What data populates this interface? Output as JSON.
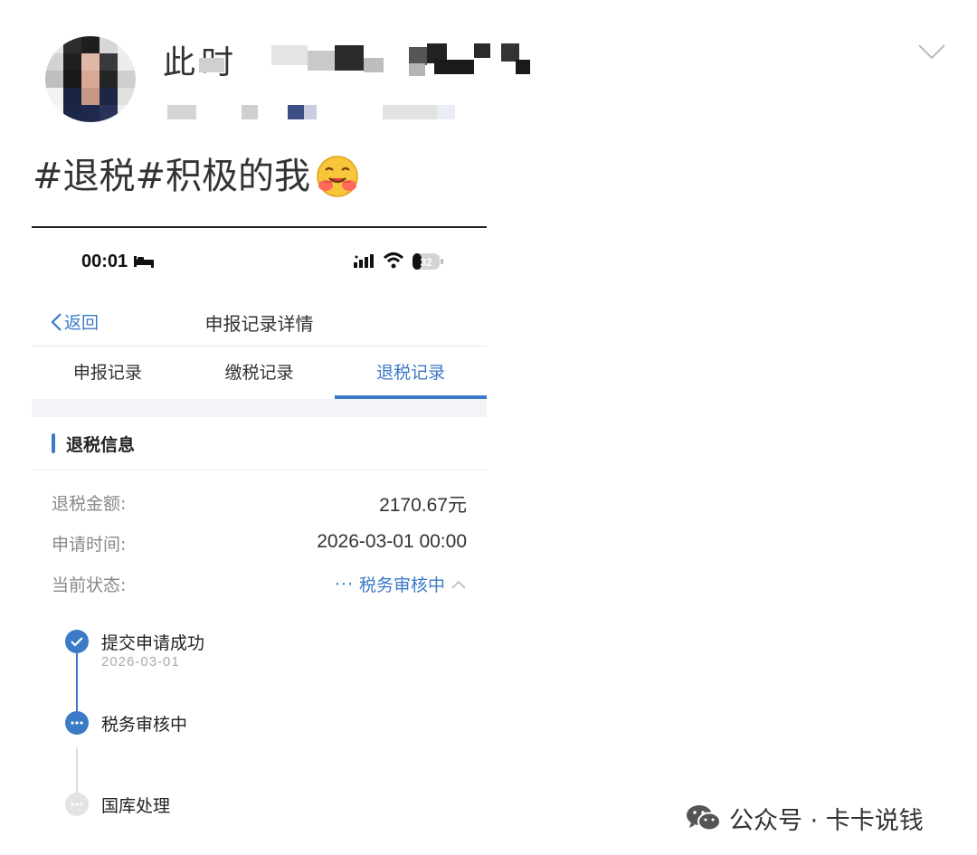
{
  "post": {
    "name_fragment": "此时",
    "hashtag_text": "#退税#积极的我",
    "emoji": "hugging-face-emoji"
  },
  "screenshot": {
    "status_bar": {
      "time": "00:01",
      "battery": "32"
    },
    "nav": {
      "back_label": "返回",
      "title": "申报记录详情"
    },
    "tabs": [
      {
        "label": "申报记录",
        "active": false
      },
      {
        "label": "缴税记录",
        "active": false
      },
      {
        "label": "退税记录",
        "active": true
      }
    ],
    "section_title": "退税信息",
    "fields": [
      {
        "label": "退税金额:",
        "value": "2170.67元"
      },
      {
        "label": "申请时间:",
        "value": "2026-03-01 00:00"
      },
      {
        "label": "当前状态:",
        "value": "税务审核中",
        "prefix": "···"
      }
    ],
    "timeline": [
      {
        "label": "提交申请成功",
        "date": "2026-03-01",
        "state": "done"
      },
      {
        "label": "税务审核中",
        "state": "current"
      },
      {
        "label": "国库处理",
        "state": "pending"
      }
    ],
    "colors": {
      "accent": "#3b7ac6",
      "grey": "#e3e3e3"
    }
  },
  "watermark": {
    "text": "公众号 · 卡卡说钱",
    "icon": "wechat-icon"
  }
}
